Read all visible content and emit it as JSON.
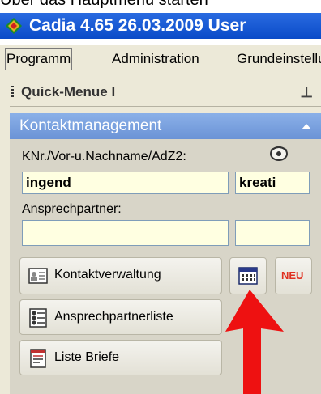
{
  "tooltip": "Über das Hauptmenü starten",
  "window": {
    "title": "Cadia 4.65  26.03.2009 User"
  },
  "menu": {
    "items": [
      "Programm",
      "Administration",
      "Grundeinstellungen"
    ]
  },
  "quickmenu": {
    "title": "Quick-Menue I"
  },
  "section": {
    "title": "Kontaktmanagement"
  },
  "form": {
    "search_label": "KNr./Vor-u.Nachname/AdZ2:",
    "search_value": "ingend",
    "search2_value": "kreati",
    "contact_label": "Ansprechpartner:",
    "contact_value": "",
    "contact2_value": ""
  },
  "buttons": {
    "kontaktverwaltung": "Kontaktverwaltung",
    "ansprechpartnerliste": "Ansprechpartnerliste",
    "liste_briefe": "Liste Briefe",
    "neu": "NEU"
  },
  "colors": {
    "titlebar": "#0a4bc8",
    "section": "#7aa2e0",
    "input_bg": "#ffffe1",
    "arrow": "#ee1111"
  }
}
